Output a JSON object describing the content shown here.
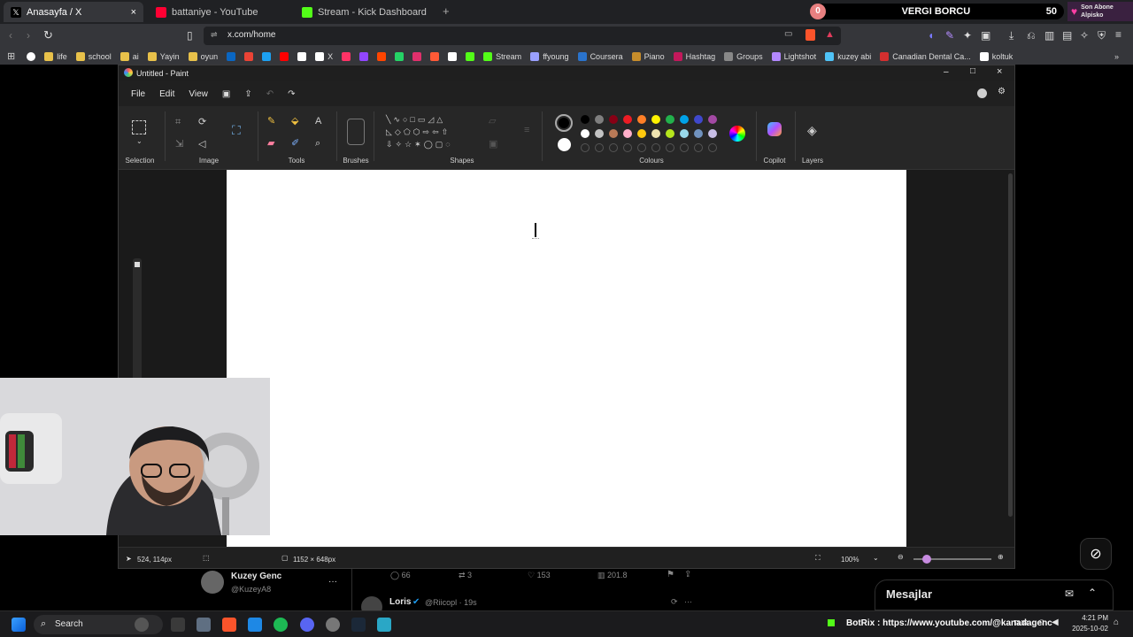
{
  "browser": {
    "tabs": [
      {
        "label": "Anasayfa / X",
        "active": true,
        "color": "#ffffff"
      },
      {
        "label": "battaniye - YouTube",
        "active": false,
        "color": "#ff0033"
      },
      {
        "label": "Stream - Kick Dashboard",
        "active": false,
        "color": "#53fc18"
      }
    ],
    "new_tab": "+",
    "url": "x.com/home",
    "bookmarks": [
      {
        "label": "life",
        "color": "#e8c14a"
      },
      {
        "label": "school",
        "color": "#e8c14a"
      },
      {
        "label": "ai",
        "color": "#e8c14a"
      },
      {
        "label": "Yayin",
        "color": "#e8c14a"
      },
      {
        "label": "oyun",
        "color": "#e8c14a"
      },
      {
        "label": "",
        "color": "#0a66c2"
      },
      {
        "label": "",
        "color": "#ea4335"
      },
      {
        "label": "",
        "color": "#1da1f2"
      },
      {
        "label": "",
        "color": "#ff0000"
      },
      {
        "label": "",
        "color": "#ffffff"
      },
      {
        "label": "X",
        "color": "#ffffff"
      },
      {
        "label": "",
        "color": "#ff3366"
      },
      {
        "label": "",
        "color": "#9146ff"
      },
      {
        "label": "",
        "color": "#ff4500"
      },
      {
        "label": "",
        "color": "#25d366"
      },
      {
        "label": "",
        "color": "#e1306c"
      },
      {
        "label": "",
        "color": "#ff5a36"
      },
      {
        "label": "",
        "color": "#ffffff"
      },
      {
        "label": "",
        "color": "#53fc18"
      },
      {
        "label": "Stream",
        "color": "#53fc18"
      },
      {
        "label": "ffyoung",
        "color": "#9aa0ff"
      },
      {
        "label": "Coursera",
        "color": "#2a73cc"
      },
      {
        "label": "Piano",
        "color": "#c78d2b"
      },
      {
        "label": "Hashtag",
        "color": "#c2185b"
      },
      {
        "label": "Groups",
        "color": "#888888"
      },
      {
        "label": "Lightshot",
        "color": "#b388ff"
      },
      {
        "label": "kuzey abi",
        "color": "#4fc3f7"
      },
      {
        "label": "Canadian Dental Ca...",
        "color": "#d32f2f"
      },
      {
        "label": "koltuk",
        "color": "#ffffff"
      }
    ],
    "more_bookmarks": "»"
  },
  "overlay": {
    "left_count": "0",
    "title": "VERGI BORCU",
    "right_count": "50",
    "side_title": "Son Abone",
    "side_name": "Alpisko"
  },
  "paint": {
    "title": "Untitled - Paint",
    "menu": [
      "File",
      "Edit",
      "View"
    ],
    "groups": {
      "selection": "Selection",
      "image": "Image",
      "tools": "Tools",
      "brushes": "Brushes",
      "shapes": "Shapes",
      "colours": "Colours",
      "copilot": "Copilot",
      "layers": "Layers"
    },
    "palette_row1": [
      "#000000",
      "#7f7f7f",
      "#880015",
      "#ed1c24",
      "#ff7f27",
      "#fff200",
      "#22b14c",
      "#00a2e8",
      "#3f48cc",
      "#a349a4"
    ],
    "palette_row2": [
      "#ffffff",
      "#c3c3c3",
      "#b97a57",
      "#ffaec9",
      "#ffc90e",
      "#efe4b0",
      "#b5e61d",
      "#99d9ea",
      "#7092be",
      "#c8bfe7"
    ],
    "primary_color": "#000000",
    "secondary_color": "#ffffff",
    "status": {
      "cursor": "524, 114px",
      "canvas_size": "1152 × 648px",
      "zoom": "100%"
    }
  },
  "feed": {
    "user_name": "Kuzey Genc",
    "user_handle": "@KuzeyA8",
    "more": "···",
    "stats": {
      "replies": "66",
      "reposts": "3",
      "likes": "153",
      "views": "201.8"
    },
    "next_author": "Loris",
    "next_handle": "@Riicopl · 19s",
    "messages": "Mesajlar"
  },
  "taskbar": {
    "search": "Search",
    "ticker": "BotRix : https://www.youtube.com/@kanadagenc",
    "lang": "TUR",
    "time": "4:21 PM",
    "date": "2025-10-02"
  }
}
